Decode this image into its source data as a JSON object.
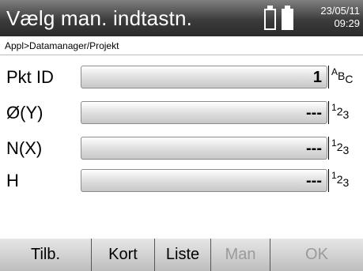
{
  "header": {
    "title": "Vælg man. indtastn.",
    "date": "23/05/11",
    "time": "09:29"
  },
  "breadcrumb": "Appl>Datamanager/Projekt",
  "fields": [
    {
      "label": "Pkt ID",
      "value": "1",
      "mode_main": "A",
      "mode_sup": "B",
      "mode_sub": "C"
    },
    {
      "label": "Ø(Y)",
      "value": "---",
      "mode_main": "1",
      "mode_sup": "2",
      "mode_sub": "3"
    },
    {
      "label": "N(X)",
      "value": "---",
      "mode_main": "1",
      "mode_sup": "2",
      "mode_sub": "3"
    },
    {
      "label": "H",
      "value": "---",
      "mode_main": "1",
      "mode_sup": "2",
      "mode_sub": "3"
    }
  ],
  "softkeys": [
    {
      "label": "Tilb.",
      "enabled": true
    },
    {
      "label": "Kort",
      "enabled": true
    },
    {
      "label": "Liste",
      "enabled": true
    },
    {
      "label": "Man",
      "enabled": false
    },
    {
      "label": "OK",
      "enabled": false
    }
  ],
  "colors": {
    "titlebar": "#3c3c3c",
    "field_bg": "#d6d6d6",
    "softkey_bg": "#cfcfcf",
    "disabled_text": "#9a9a9a"
  },
  "icons": [
    "battery-icon",
    "battery-icon"
  ]
}
